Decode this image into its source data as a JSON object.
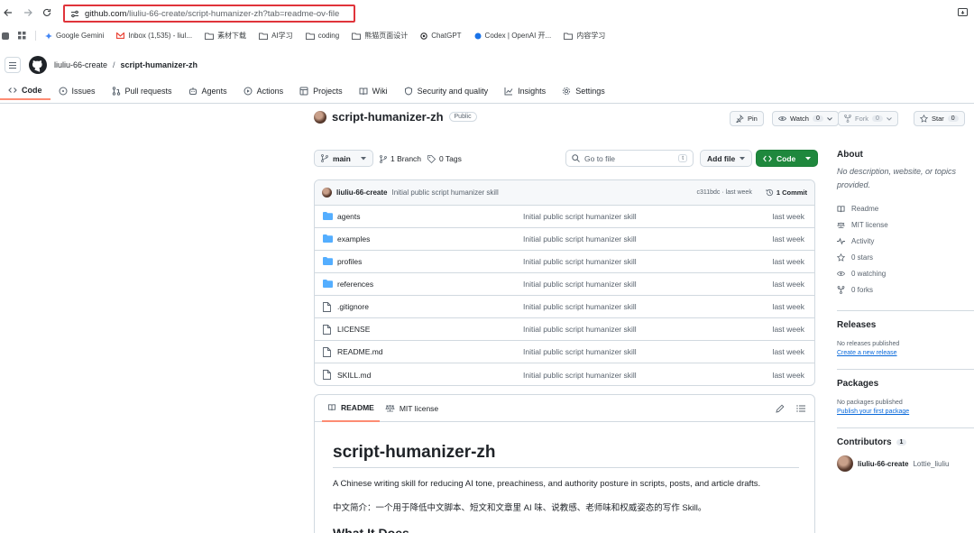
{
  "browser": {
    "url_host": "github.com",
    "url_path": "/liuliu-66-create/script-humanizer-zh?tab=readme-ov-file",
    "bookmarks": [
      {
        "label": "Google Gemini",
        "color": "#4285f4"
      },
      {
        "label": "Inbox (1,535) - liul...",
        "color": "#ea4335"
      },
      {
        "label": "素材下载",
        "color": "#5f6368"
      },
      {
        "label": "AI学习",
        "color": "#5f6368"
      },
      {
        "label": "coding",
        "color": "#5f6368"
      },
      {
        "label": "熊猫页面设计",
        "color": "#5f6368"
      },
      {
        "label": "ChatGPT",
        "color": "#202124"
      },
      {
        "label": "Codex | OpenAI 开...",
        "color": "#1a73e8"
      },
      {
        "label": "内容学习",
        "color": "#5f6368"
      }
    ]
  },
  "header": {
    "owner": "liuliu-66-create",
    "separator": "/",
    "repo": "script-humanizer-zh",
    "tabs": [
      {
        "label": "Code",
        "icon": "code-icon",
        "active": true
      },
      {
        "label": "Issues",
        "icon": "issue-icon"
      },
      {
        "label": "Pull requests",
        "icon": "pull-request-icon"
      },
      {
        "label": "Agents",
        "icon": "agents-icon"
      },
      {
        "label": "Actions",
        "icon": "play-icon"
      },
      {
        "label": "Projects",
        "icon": "table-icon"
      },
      {
        "label": "Wiki",
        "icon": "book-icon"
      },
      {
        "label": "Security and quality",
        "icon": "shield-icon"
      },
      {
        "label": "Insights",
        "icon": "graph-icon"
      },
      {
        "label": "Settings",
        "icon": "gear-icon"
      }
    ]
  },
  "repo": {
    "name": "script-humanizer-zh",
    "visibility": "Public",
    "pin": "Pin",
    "watch": "Watch",
    "watch_count": "0",
    "fork": "Fork",
    "fork_count": "0",
    "star": "Star",
    "star_count": "0"
  },
  "toolbar": {
    "branch": "main",
    "branches": "1 Branch",
    "tags": "0 Tags",
    "goto_placeholder": "Go to file",
    "goto_key": "t",
    "add_file": "Add file",
    "code": "Code"
  },
  "commit": {
    "author": "liuliu-66-create",
    "message": "Initial public script humanizer skill",
    "meta": "c311bdc · last week",
    "count": "1 Commit"
  },
  "files": [
    {
      "name": "agents",
      "type": "dir",
      "message": "Initial public script humanizer skill",
      "date": "last week"
    },
    {
      "name": "examples",
      "type": "dir",
      "message": "Initial public script humanizer skill",
      "date": "last week"
    },
    {
      "name": "profiles",
      "type": "dir",
      "message": "Initial public script humanizer skill",
      "date": "last week"
    },
    {
      "name": "references",
      "type": "dir",
      "message": "Initial public script humanizer skill",
      "date": "last week"
    },
    {
      "name": ".gitignore",
      "type": "file",
      "message": "Initial public script humanizer skill",
      "date": "last week"
    },
    {
      "name": "LICENSE",
      "type": "file",
      "message": "Initial public script humanizer skill",
      "date": "last week"
    },
    {
      "name": "README.md",
      "type": "file",
      "message": "Initial public script humanizer skill",
      "date": "last week"
    },
    {
      "name": "SKILL.md",
      "type": "file",
      "message": "Initial public script humanizer skill",
      "date": "last week"
    }
  ],
  "readme": {
    "tab_readme": "README",
    "tab_license": "MIT license",
    "title": "script-humanizer-zh",
    "p1": "A Chinese writing skill for reducing AI tone, preachiness, and authority posture in scripts, posts, and article drafts.",
    "p2": "中文简介：一个用于降低中文脚本、短文和文章里 AI 味、说教感、老师味和权威姿态的写作 Skill。",
    "h2": "What It Does"
  },
  "sidebar": {
    "about_title": "About",
    "about_desc": "No description, website, or topics provided.",
    "items": [
      {
        "label": "Readme",
        "icon": "book-icon"
      },
      {
        "label": "MIT license",
        "icon": "law-icon"
      },
      {
        "label": "Activity",
        "icon": "pulse-icon"
      },
      {
        "label": "0 stars",
        "icon": "star-icon"
      },
      {
        "label": "0 watching",
        "icon": "eye-icon"
      },
      {
        "label": "0 forks",
        "icon": "fork-icon"
      }
    ],
    "releases_title": "Releases",
    "releases_none": "No releases published",
    "releases_link": "Create a new release",
    "packages_title": "Packages",
    "packages_none": "No packages published",
    "packages_link": "Publish your first package",
    "contributors_title": "Contributors",
    "contributors_count": "1",
    "contributor_login": "liuliu-66-create",
    "contributor_name": "Lottie_liuliu"
  },
  "colors": {
    "accent_link": "#0969da",
    "green_button": "#1f883d",
    "active_tab_underline": "#fd8c73",
    "url_highlight": "#e0343b",
    "folder": "#54aeff"
  }
}
